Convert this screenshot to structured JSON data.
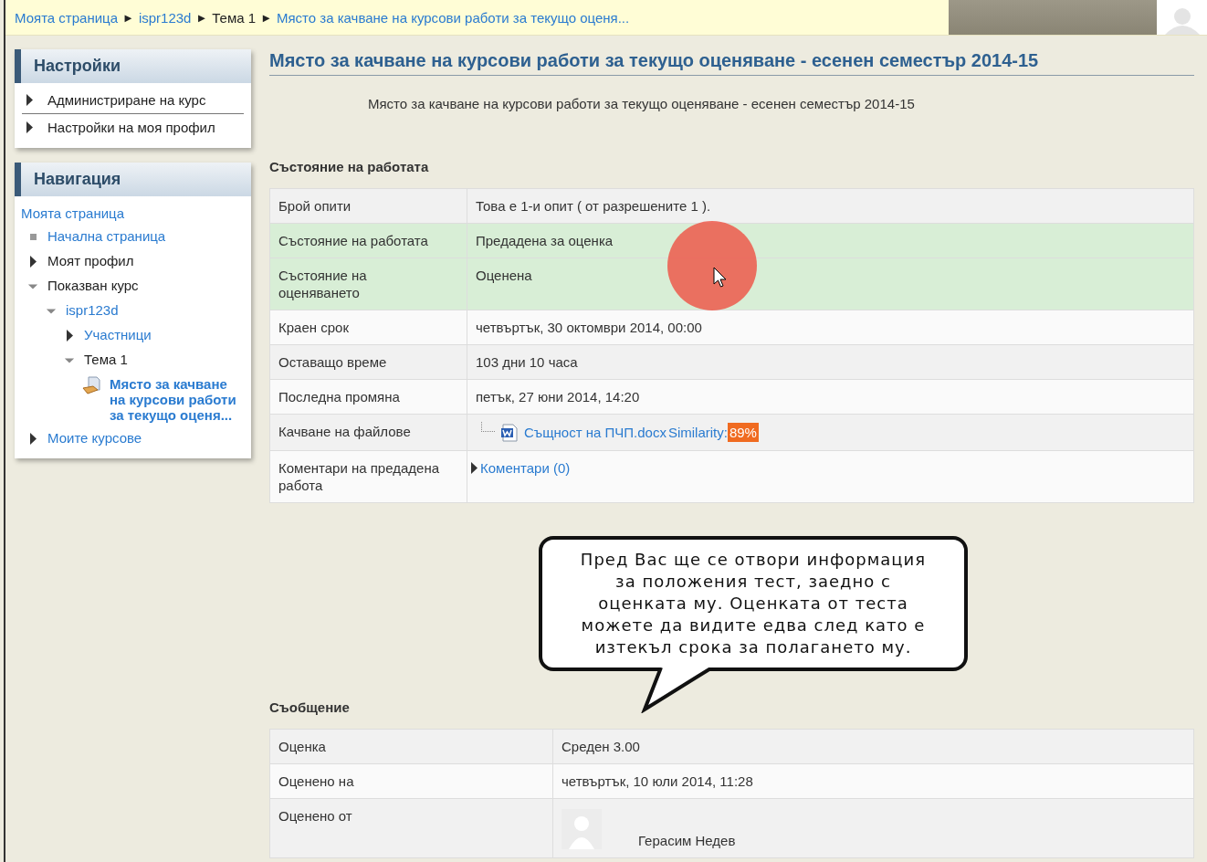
{
  "breadcrumb": {
    "separator": "►",
    "items": [
      {
        "label": "Моята страница",
        "kind": "link"
      },
      {
        "label": "ispr123d",
        "kind": "link"
      },
      {
        "label": "Тема 1",
        "kind": "text"
      },
      {
        "label": "Място за качване на курсови работи за текущо оценя...",
        "kind": "link"
      }
    ]
  },
  "sidebar": {
    "settings": {
      "title": "Настройки",
      "items": [
        {
          "label": "Администриране на курс",
          "expanded": false
        },
        {
          "label": "Настройки на моя профил",
          "expanded": false
        }
      ]
    },
    "navigation": {
      "title": "Навигация",
      "home": "Моята страница",
      "items": [
        {
          "label": "Начална страница",
          "kind": "leaf",
          "link": true
        },
        {
          "label": "Моят профил",
          "kind": "branch",
          "expanded": false,
          "link": false
        },
        {
          "label": "Показван курс",
          "kind": "branch",
          "expanded": true,
          "link": false,
          "children": [
            {
              "label": "ispr123d",
              "kind": "branch",
              "expanded": true,
              "link": true,
              "children": [
                {
                  "label": "Участници",
                  "kind": "branch",
                  "expanded": false,
                  "link": true
                },
                {
                  "label": "Тема 1",
                  "kind": "branch",
                  "expanded": true,
                  "link": false,
                  "children": [
                    {
                      "label": "Място за качване на курсови работи за текущо оценя...",
                      "kind": "activity",
                      "link": true,
                      "current": true
                    }
                  ]
                }
              ]
            }
          ]
        },
        {
          "label": "Моите курсове",
          "kind": "branch",
          "expanded": false,
          "link": true
        }
      ]
    }
  },
  "main": {
    "title": "Място за качване на курсови работи за текущо оценяване - есенен семестър 2014-15",
    "intro": "Място за качване на курсови работи за текущо оценяване - есенен семестър 2014-15",
    "submission_status": {
      "heading": "Състояние на работата",
      "rows": [
        {
          "label": "Брой опити",
          "kind": "text",
          "value": "Това е 1-и опит ( от разрешените 1 ).",
          "highlight": false
        },
        {
          "label": "Състояние на работата",
          "kind": "text",
          "value": "Предадена за оценка",
          "highlight": true
        },
        {
          "label": "Състояние на оценяването",
          "kind": "text",
          "value": "Оценена",
          "highlight": true
        },
        {
          "label": "Краен срок",
          "kind": "text",
          "value": "четвъртък, 30 октомври 2014, 00:00",
          "highlight": false
        },
        {
          "label": "Оставащо време",
          "kind": "text",
          "value": "103 дни 10 часа",
          "highlight": false
        },
        {
          "label": "Последна промяна",
          "kind": "text",
          "value": "петък, 27 юни 2014, 14:20",
          "highlight": false
        },
        {
          "label": "Качване на файлове",
          "kind": "file",
          "file_name": "Същност на ПЧП.docx",
          "similarity_label": "Similarity:",
          "similarity": "89%",
          "highlight": false
        },
        {
          "label": "Коментари на предадена работа",
          "kind": "comments",
          "value": "Коментари (0)",
          "expanded": false,
          "highlight": false
        }
      ]
    },
    "feedback": {
      "heading": "Съобщение",
      "rows": [
        {
          "label": "Оценка",
          "kind": "text",
          "value": "Среден 3.00"
        },
        {
          "label": "Оценено на",
          "kind": "text",
          "value": "четвъртък, 10 юли 2014, 11:28"
        },
        {
          "label": "Оценено от",
          "kind": "grader",
          "value": "Герасим Недев"
        }
      ]
    }
  },
  "callout": {
    "lines": [
      "Пред Вас ще се отвори информация",
      "за положения тест, заедно с",
      "оценката му. Оценката от теста",
      "можете да видите едва след като е",
      "изтекъл срока за полагането му."
    ]
  }
}
